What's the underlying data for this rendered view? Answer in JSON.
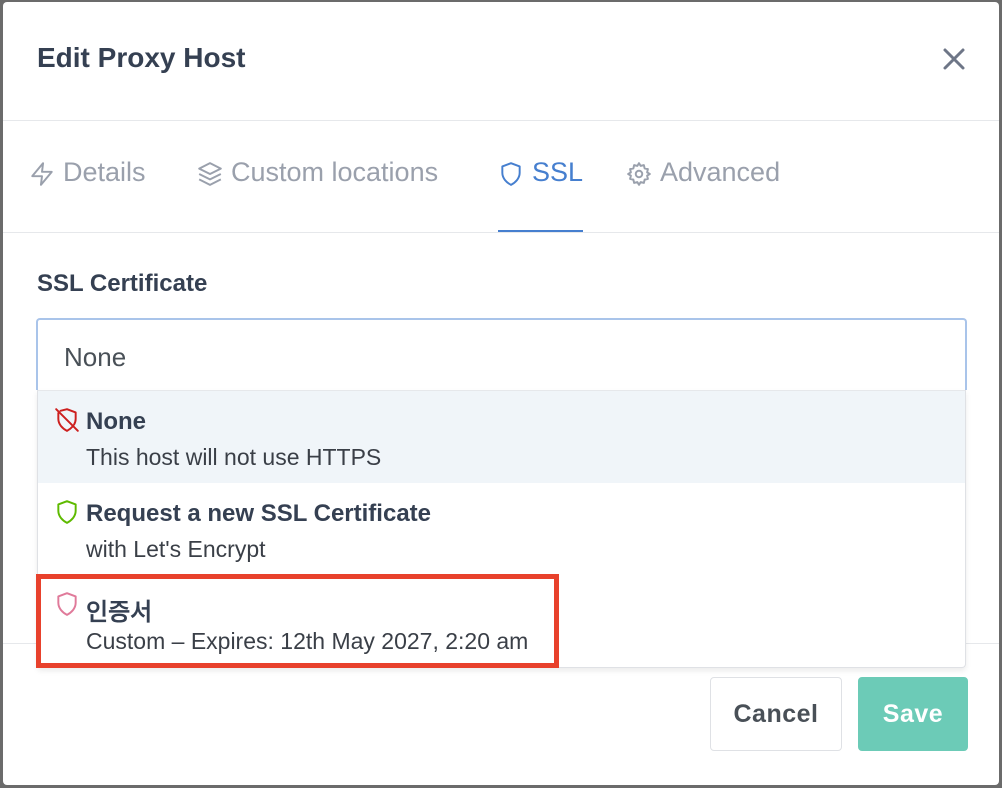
{
  "modal": {
    "title": "Edit Proxy Host"
  },
  "tabs": [
    {
      "label": "Details",
      "icon": "bolt-icon",
      "active": false
    },
    {
      "label": "Custom locations",
      "icon": "layers-icon",
      "active": false
    },
    {
      "label": "SSL",
      "icon": "shield-icon",
      "active": true
    },
    {
      "label": "Advanced",
      "icon": "gear-icon",
      "active": false
    }
  ],
  "ssl": {
    "field_label": "SSL Certificate",
    "selected_value": "None",
    "options": [
      {
        "title": "None",
        "subtitle": "This host will not use HTTPS",
        "icon": "shield-off-icon",
        "icon_color": "#cd201f"
      },
      {
        "title": "Request a new SSL Certificate",
        "subtitle": "with Let's Encrypt",
        "icon": "shield-icon",
        "icon_color": "#5eba00"
      },
      {
        "title": "인증서",
        "subtitle": "Custom – Expires: 12th May 2027, 2:20 am",
        "icon": "shield-icon",
        "icon_color": "#e07a9a"
      }
    ]
  },
  "footer": {
    "cancel_label": "Cancel",
    "save_label": "Save"
  },
  "colors": {
    "accent": "#467fcf",
    "save": "#6ccbb7",
    "highlight_box": "#e8412c"
  }
}
